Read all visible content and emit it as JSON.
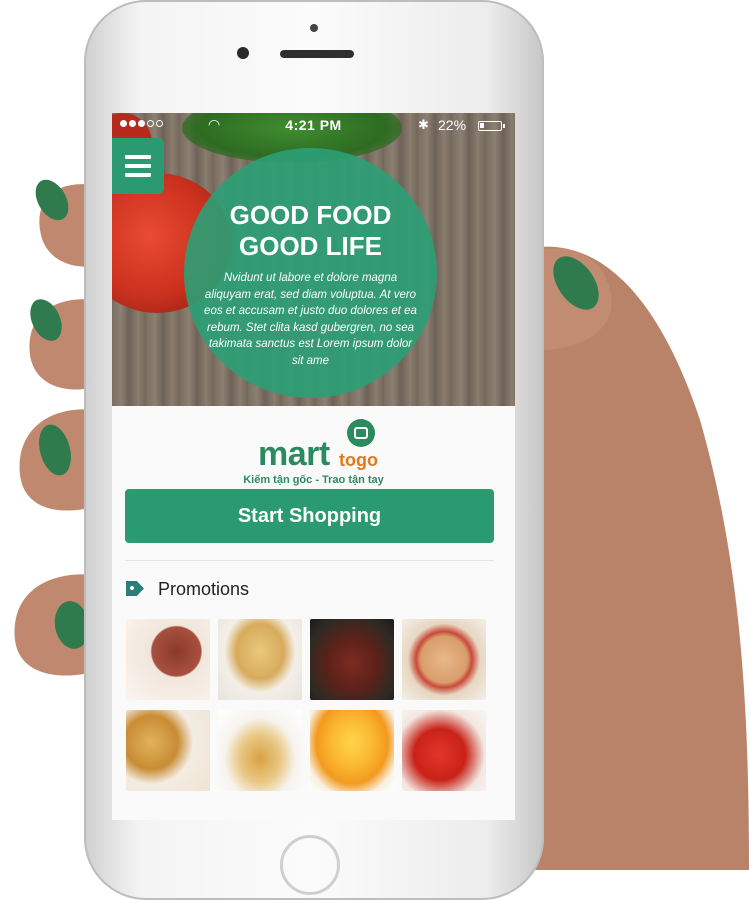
{
  "status_bar": {
    "time": "4:21 PM",
    "battery_percent": "22%",
    "battery_level": 0.22,
    "signal_bars": 3,
    "signal_total": 5
  },
  "hero": {
    "headline_line1": "GOOD FOOD",
    "headline_line2": "GOOD LIFE",
    "body": "Nvidunt ut labore et dolore magna aliquyam erat, sed diam voluptua. At vero eos et accusam et justo duo dolores et ea rebum. Stet clita kasd gubergren, no sea takimata sanctus est Lorem ipsum dolor sit ame"
  },
  "brand": {
    "name_main": "mart",
    "name_suffix": "togo",
    "tagline": "Kiếm tận gốc - Trao tận tay"
  },
  "cta": {
    "start_label": "Start Shopping"
  },
  "promotions": {
    "title": "Promotions",
    "items": [
      {
        "icon": "sliced-meat-image"
      },
      {
        "icon": "casserole-image"
      },
      {
        "icon": "roast-beef-image"
      },
      {
        "icon": "pizza-image"
      },
      {
        "icon": "quiche-image"
      },
      {
        "icon": "tea-glass-image"
      },
      {
        "icon": "orange-juice-image"
      },
      {
        "icon": "strawberries-image"
      }
    ]
  },
  "colors": {
    "brand_green": "#2a9a70",
    "brand_orange": "#e07a1a"
  }
}
